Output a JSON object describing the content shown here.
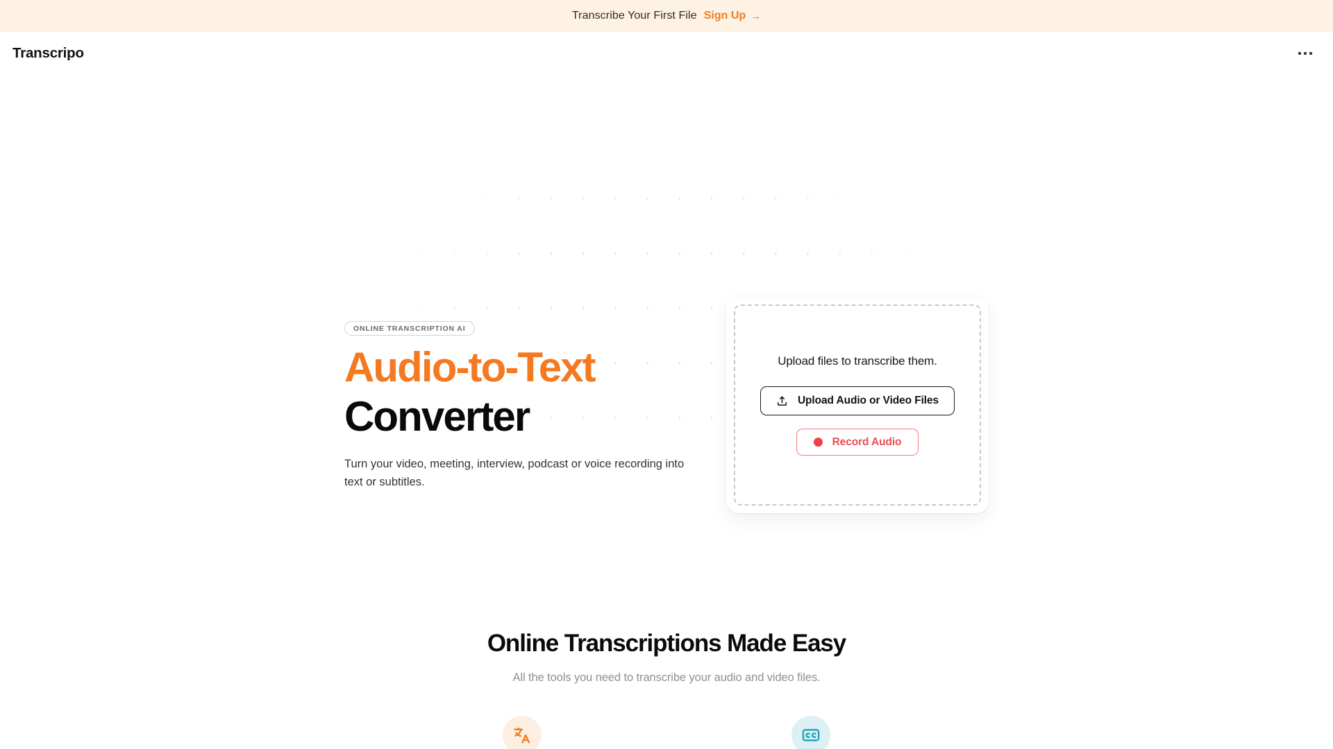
{
  "announcement": {
    "text": "Transcribe Your First File",
    "link_label": "Sign Up",
    "arrow": "→",
    "bg_color": "#fdf2e4",
    "link_color": "#f07c1e"
  },
  "header": {
    "brand": "Transcripo",
    "menu_icon": "ellipsis-horizontal-icon"
  },
  "hero": {
    "badge": "ONLINE TRANSCRIPTION AI",
    "title_accent": "Audio-to-Text",
    "title_plain": "Converter",
    "accent_color": "#f47920",
    "subtitle": "Turn your video, meeting, interview, podcast or voice recording into text or subtitles."
  },
  "upload_card": {
    "prompt": "Upload files to transcribe them.",
    "upload_button": "Upload Audio or Video Files",
    "upload_icon": "upload-icon",
    "record_button": "Record Audio",
    "record_icon": "record-dot-icon",
    "record_color": "#ef4a52"
  },
  "features": {
    "title": "Online Transcriptions Made Easy",
    "subtitle": "All the tools you need to transcribe your audio and video files.",
    "items": [
      {
        "icon": "translate-icon",
        "icon_color": "#f47920",
        "circle_color": "#fdeee2"
      },
      {
        "icon": "closed-captions-icon",
        "icon_color": "#19a3bd",
        "circle_color": "#ddf1f4"
      }
    ]
  }
}
